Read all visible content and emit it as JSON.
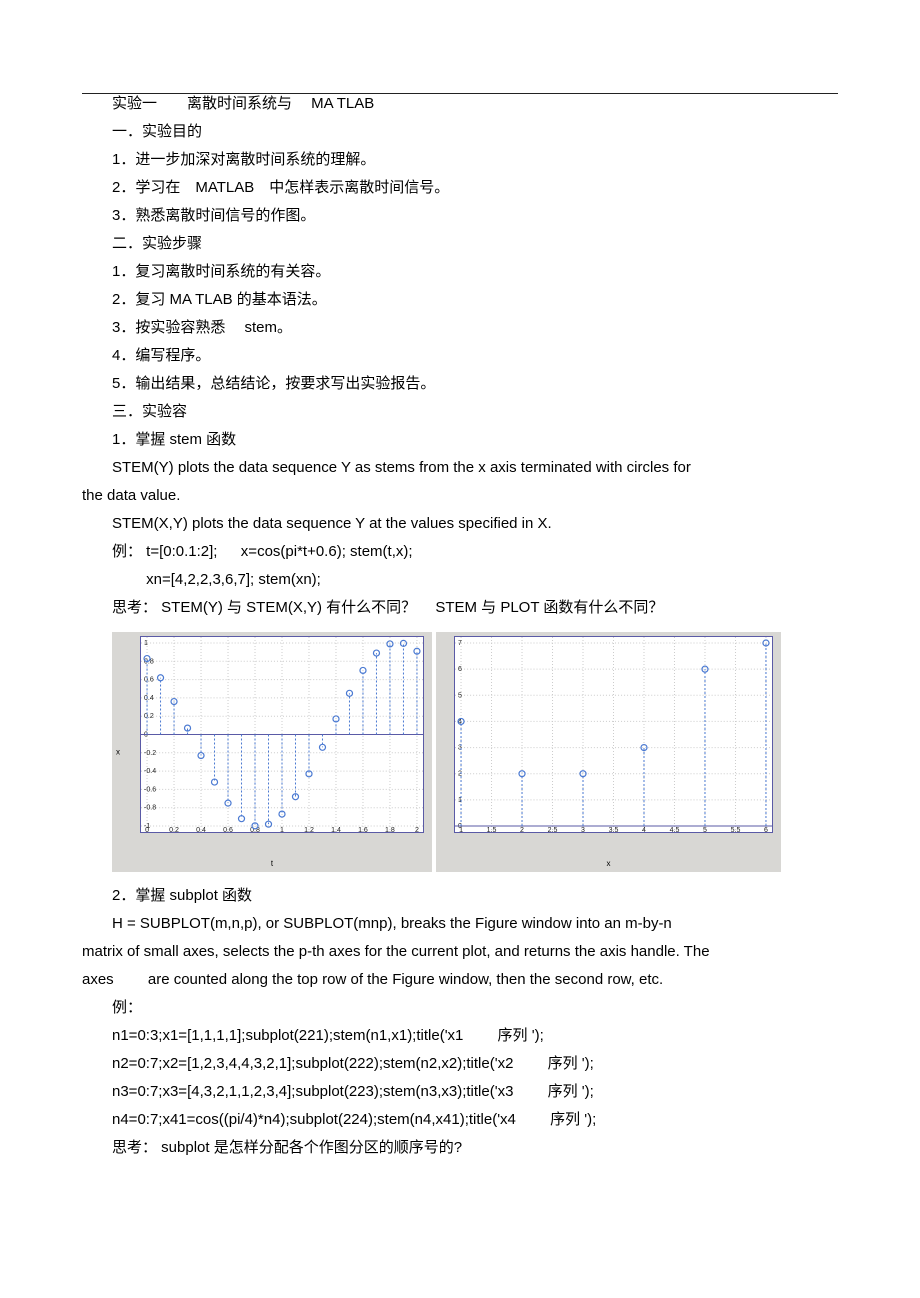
{
  "hr": "_________________________________________",
  "title_line": "实验一　　离散时间系统与 　MA TLAB",
  "s1_h": "一．实验目的",
  "s1_1": "1．进一步加深对离散时间系统的理解。",
  "s1_2": "2．学习在　MATLAB　中怎样表示离散时间信号。",
  "s1_3": "3．熟悉离散时间信号的作图。",
  "s2_h": "二．实验步骤",
  "s2_1": "1．复习离散时间系统的有关容。",
  "s2_2": "2．复习 MA TLAB  的基本语法。",
  "s2_3": "3．按实验容熟悉　  stem。",
  "s2_4": "4．编写程序。",
  "s2_5": "5．输出结果，总结结论，按要求写出实验报告。",
  "s3_h": "三．实验容",
  "s3_1t": "1．掌握 stem 函数",
  "stem_desc1a": "STEM(Y) plots the data sequence Y as stems from the x axis terminated with circles for",
  "stem_desc1b": "the data value.",
  "stem_desc2": "STEM(X,Y) plots the data sequence Y at the values specified in X.",
  "ex_l1": "例： t=[0:0.1:2]; 　 x=cos(pi*t+0.6); stem(t,x);",
  "ex_l2": "　　 xn=[4,2,2,3,6,7]; stem(xn);",
  "think1": "思考： STEM(Y) 与 STEM(X,Y) 有什么不同？ 　STEM 与 PLOT 函数有什么不同？",
  "s3_2t": "2．掌握 subplot 函数",
  "sub_desc_a": "H  =  SUBPLOT(m,n,p),    or  SUBPLOT(mnp),    breaks  the  Figure  window   into   an  m-by-n",
  "sub_desc_b": "matrix of small axes, selects the p-th axes for the current plot, and returns the axis handle. The",
  "sub_desc_c": "axes 　　are counted along the top row of the Figure window, then the second row, etc.",
  "ex2_h": "例：",
  "ex2_1": "n1=0:3;x1=[1,1,1,1];subplot(221);stem(n1,x1);title('x1 　　序列 ');",
  "ex2_2": "n2=0:7;x2=[1,2,3,4,4,3,2,1];subplot(222);stem(n2,x2);title('x2 　　序列 ');",
  "ex2_3": "n3=0:7;x3=[4,3,2,1,1,2,3,4];subplot(223);stem(n3,x3);title('x3 　　序列 ');",
  "ex2_4": "n4=0:7;x41=cos((pi/4)*n4);subplot(224);stem(n4,x41);title('x4 　　序列 ');",
  "think2": "思考： subplot 是怎样分配各个作图分区的顺序号的?",
  "chart_data": [
    {
      "type": "stem",
      "x": [
        0,
        0.1,
        0.2,
        0.3,
        0.4,
        0.5,
        0.6,
        0.7,
        0.8,
        0.9,
        1.0,
        1.1,
        1.2,
        1.3,
        1.4,
        1.5,
        1.6,
        1.7,
        1.8,
        1.9,
        2.0
      ],
      "y": [
        0.83,
        0.62,
        0.36,
        0.07,
        -0.23,
        -0.52,
        -0.75,
        -0.92,
        -0.998,
        -0.98,
        -0.87,
        -0.68,
        -0.43,
        -0.14,
        0.17,
        0.45,
        0.7,
        0.89,
        0.99,
        0.996,
        0.91
      ],
      "xlabel": "t",
      "ylabel": "x",
      "xticks": [
        0,
        0.2,
        0.4,
        0.6,
        0.8,
        1.0,
        1.2,
        1.4,
        1.6,
        1.8,
        2.0
      ],
      "yticks": [
        -1,
        -0.8,
        -0.6,
        -0.4,
        -0.2,
        0,
        0.2,
        0.4,
        0.6,
        0.8,
        1.0
      ],
      "xlim": [
        0,
        2
      ],
      "ylim": [
        -1,
        1
      ]
    },
    {
      "type": "stem",
      "x": [
        1,
        2,
        3,
        4,
        5,
        6
      ],
      "y": [
        4,
        2,
        2,
        3,
        6,
        7
      ],
      "xlabel": "x",
      "ylabel": "",
      "xticks": [
        1,
        1.5,
        2,
        2.5,
        3,
        3.5,
        4,
        4.5,
        5,
        5.5,
        6
      ],
      "yticks": [
        0,
        1,
        2,
        3,
        4,
        5,
        6,
        7
      ],
      "xlim": [
        1,
        6
      ],
      "ylim": [
        0,
        7
      ]
    }
  ]
}
